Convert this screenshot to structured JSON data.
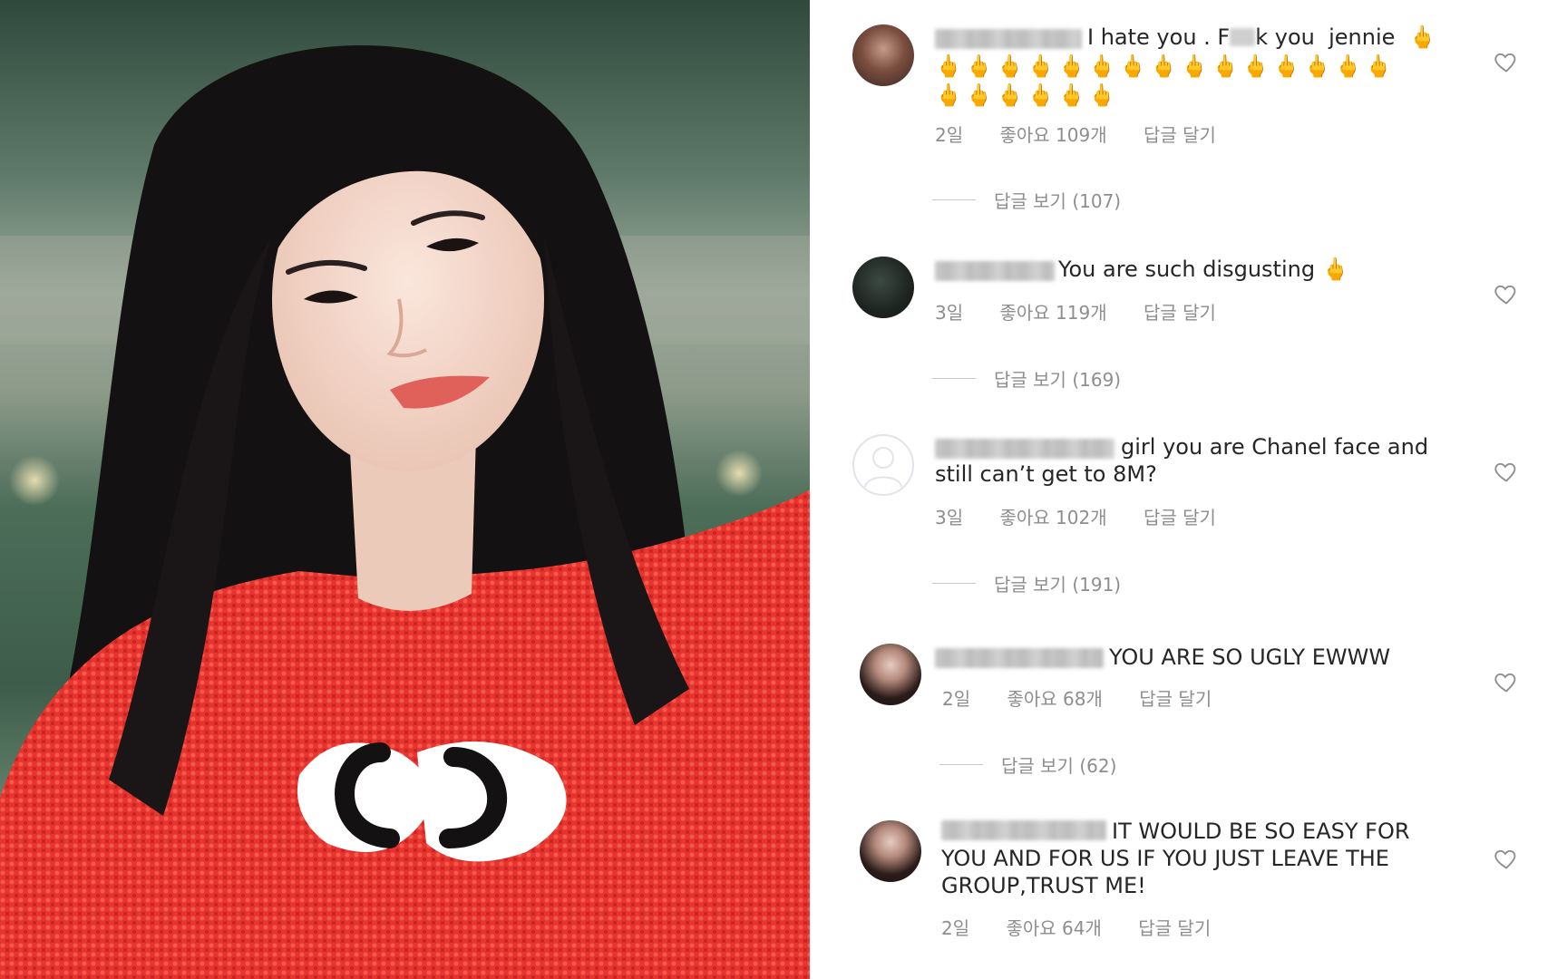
{
  "comments": [
    {
      "avatar_icon": "user-avatar",
      "text": "I hate you . F",
      "text_after_censor": "k you  jennie",
      "emoji_line1": "🖕",
      "emoji_line2": "🖕🖕🖕🖕🖕🖕🖕🖕🖕🖕🖕🖕🖕🖕🖕",
      "emoji_line3": "🖕🖕🖕🖕🖕🖕",
      "time": "2일",
      "likes": "좋아요 109개",
      "reply": "답글 달기",
      "view_replies": "답글 보기 (107)"
    },
    {
      "avatar_icon": "user-avatar",
      "text": "You are such disgusting 🖕",
      "time": "3일",
      "likes": "좋아요 119개",
      "reply": "답글 달기",
      "view_replies": "답글 보기 (169)"
    },
    {
      "avatar_icon": "default-avatar-icon",
      "text": "girl you are Chanel face and",
      "text_line2": "still can’t get to 8M?",
      "time": "3일",
      "likes": "좋아요 102개",
      "reply": "답글 달기",
      "view_replies": "답글 보기 (191)"
    },
    {
      "avatar_icon": "user-avatar",
      "text": "YOU ARE SO UGLY EWWW",
      "time": "2일",
      "likes": "좋아요 68개",
      "reply": "답글 달기",
      "view_replies": "답글 보기 (62)"
    },
    {
      "avatar_icon": "user-avatar",
      "text": "IT WOULD BE SO EASY FOR",
      "text_line2": "YOU AND FOR US IF YOU JUST LEAVE THE",
      "text_line3": "GROUP,TRUST ME!",
      "time": "2일",
      "likes": "좋아요 64개",
      "reply": "답글 달기"
    }
  ],
  "photo": {
    "sweater_color": "#e8332e",
    "logo": "CC"
  }
}
